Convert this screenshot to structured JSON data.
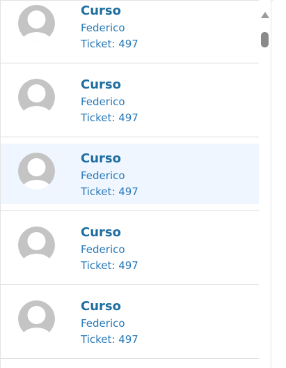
{
  "colors": {
    "title": "#1f6ea0",
    "text": "#2a7ab8",
    "selected_bg": "#f0f6ff",
    "avatar": "#c4c4c4",
    "divider": "#dcdcdc"
  },
  "list": {
    "items": [
      {
        "title": "Curso",
        "name": "Federico",
        "ticket": "Ticket: 497",
        "selected": false,
        "avatar_icon": "default-user-icon"
      },
      {
        "title": "Curso",
        "name": "Federico",
        "ticket": "Ticket: 497",
        "selected": false,
        "avatar_icon": "default-user-icon"
      },
      {
        "title": "Curso",
        "name": "Federico",
        "ticket": "Ticket: 497",
        "selected": true,
        "avatar_icon": "default-user-icon"
      },
      {
        "title": "Curso",
        "name": "Federico",
        "ticket": "Ticket: 497",
        "selected": false,
        "avatar_icon": "default-user-icon"
      },
      {
        "title": "Curso",
        "name": "Federico",
        "ticket": "Ticket: 497",
        "selected": false,
        "avatar_icon": "default-user-icon"
      }
    ]
  },
  "scrollbar": {
    "up_icon": "arrow-up-icon"
  }
}
